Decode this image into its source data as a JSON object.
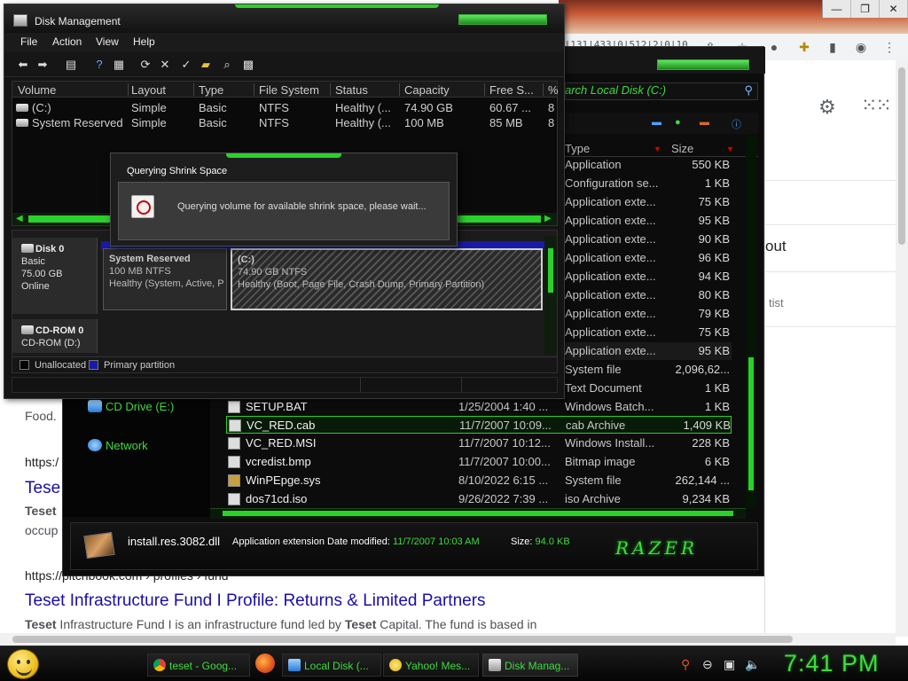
{
  "chrome": {
    "url_fragment": "0|131|433|0|512|2|0|10",
    "window_buttons": [
      "—",
      "❐",
      "✕"
    ],
    "google_partial_text_1": "out",
    "google_partial_text_2": "tist"
  },
  "search_results": {
    "snippet_top_fragment": "Food.",
    "result1_url_fragment": "https:/",
    "result1_title_fragment": "Tese",
    "result1_snippet_bold": "Teset",
    "result1_snippet_fragment": "occup",
    "result2_url": "https://pitchbook.com › profiles › fund",
    "result2_title": "Teset Infrastructure Fund I Profile: Returns & Limited Partners",
    "result2_snippet_b1": "Teset",
    "result2_snippet_t1": " Infrastructure Fund I is an infrastructure fund led by ",
    "result2_snippet_b2": "Teset",
    "result2_snippet_t2": " Capital. The fund is based in"
  },
  "explorer": {
    "search_placeholder": "arch Local Disk (C:)",
    "columns": {
      "type": "Type",
      "size": "Size"
    },
    "sidebar": {
      "cd_drive": "CD Drive (E:)",
      "network": "Network"
    },
    "top_rows": [
      {
        "type": "Application",
        "size": "550 KB"
      },
      {
        "type": "Configuration se...",
        "size": "1 KB"
      },
      {
        "type": "Application exte...",
        "size": "75 KB"
      },
      {
        "type": "Application exte...",
        "size": "95 KB"
      },
      {
        "type": "Application exte...",
        "size": "90 KB"
      },
      {
        "type": "Application exte...",
        "size": "96 KB"
      },
      {
        "type": "Application exte...",
        "size": "94 KB"
      },
      {
        "type": "Application exte...",
        "size": "80 KB"
      },
      {
        "type": "Application exte...",
        "size": "79 KB"
      },
      {
        "type": "Application exte...",
        "size": "75 KB"
      },
      {
        "type": "Application exte...",
        "size": "95 KB"
      },
      {
        "type": "System file",
        "size": "2,096,62..."
      },
      {
        "type": "Text Document",
        "size": "1 KB"
      }
    ],
    "files": [
      {
        "name": "SETUP.BAT",
        "date": "1/25/2004 1:40 ...",
        "type": "Windows Batch...",
        "size": "1 KB"
      },
      {
        "name": "VC_RED.cab",
        "date": "11/7/2007 10:09...",
        "type": "cab Archive",
        "size": "1,409 KB"
      },
      {
        "name": "VC_RED.MSI",
        "date": "11/7/2007 10:12...",
        "type": "Windows Install...",
        "size": "228 KB"
      },
      {
        "name": "vcredist.bmp",
        "date": "11/7/2007 10:00...",
        "type": "Bitmap image",
        "size": "6 KB"
      },
      {
        "name": "WinPEpge.sys",
        "date": "8/10/2022 6:15 ...",
        "type": "System file",
        "size": "262,144 ..."
      },
      {
        "name": "dos71cd.iso",
        "date": "9/26/2022 7:39 ...",
        "type": "iso Archive",
        "size": "9,234 KB"
      }
    ],
    "details": {
      "name": "install.res.3082.dll",
      "type": "Application extension",
      "modified_label": "Date modified:",
      "modified": "11/7/2007 10:03 AM",
      "size_label": "Size:",
      "size": "94.0 KB",
      "brand_logo": "RAZER"
    }
  },
  "disk_mgmt": {
    "title": "Disk Management",
    "menu": [
      "File",
      "Action",
      "View",
      "Help"
    ],
    "columns": [
      "Volume",
      "Layout",
      "Type",
      "File System",
      "Status",
      "Capacity",
      "Free S...",
      "%"
    ],
    "volumes": [
      {
        "volume": "(C:)",
        "layout": "Simple",
        "type": "Basic",
        "fs": "NTFS",
        "status": "Healthy (...",
        "capacity": "74.90 GB",
        "free": "60.67 ...",
        "pct": "8"
      },
      {
        "volume": "System Reserved",
        "layout": "Simple",
        "type": "Basic",
        "fs": "NTFS",
        "status": "Healthy (...",
        "capacity": "100 MB",
        "free": "85 MB",
        "pct": "8"
      }
    ],
    "disk0": {
      "name": "Disk 0",
      "type": "Basic",
      "size": "75.00 GB",
      "state": "Online"
    },
    "partitions": [
      {
        "name": "System Reserved",
        "size": "100 MB NTFS",
        "status": "Healthy (System, Active, P"
      },
      {
        "name": "(C:)",
        "size": "74.90 GB NTFS",
        "status": "Healthy (Boot, Page File, Crash Dump, Primary Partition)"
      }
    ],
    "cdrom": {
      "name": "CD-ROM 0",
      "desc": "CD-ROM (D:)"
    },
    "legend": {
      "unallocated": "Unallocated",
      "primary": "Primary partition"
    },
    "colors": {
      "unallocated": "#000000",
      "primary": "#1a1aa8"
    }
  },
  "dialog": {
    "title": "Querying Shrink Space",
    "message": "Querying volume for available shrink space, please wait..."
  },
  "taskbar": {
    "tasks": [
      {
        "label": "teset - Goog..."
      },
      {
        "label": "Local Disk (..."
      },
      {
        "label": "Yahoo! Mes..."
      },
      {
        "label": "Disk Manag..."
      }
    ],
    "clock": "7:41 PM"
  },
  "theme": {
    "accent": "#3ddc3d",
    "background": "#0c0c0c"
  }
}
